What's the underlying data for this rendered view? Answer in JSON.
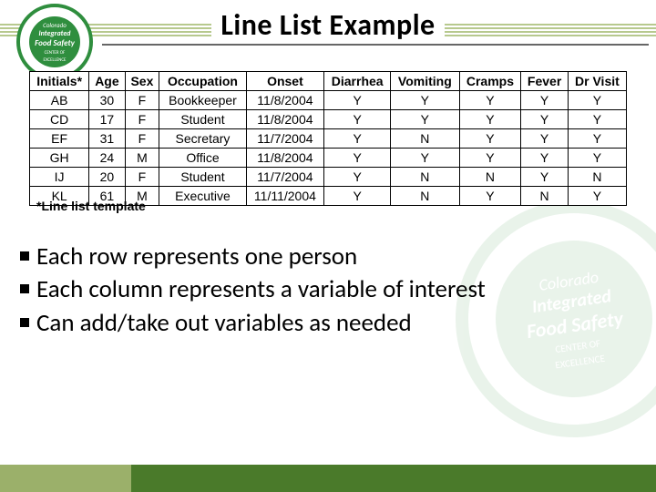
{
  "title": "Line List Example",
  "logo": {
    "line1": "Colorado",
    "line2": "Integrated",
    "line3": "Food Safety",
    "line4": "CENTER OF",
    "line5": "EXCELLENCE"
  },
  "table": {
    "headers": [
      "Initials*",
      "Age",
      "Sex",
      "Occupation",
      "Onset",
      "Diarrhea",
      "Vomiting",
      "Cramps",
      "Fever",
      "Dr Visit"
    ],
    "rows": [
      [
        "AB",
        "30",
        "F",
        "Bookkeeper",
        "11/8/2004",
        "Y",
        "Y",
        "Y",
        "Y",
        "Y"
      ],
      [
        "CD",
        "17",
        "F",
        "Student",
        "11/8/2004",
        "Y",
        "Y",
        "Y",
        "Y",
        "Y"
      ],
      [
        "EF",
        "31",
        "F",
        "Secretary",
        "11/7/2004",
        "Y",
        "N",
        "Y",
        "Y",
        "Y"
      ],
      [
        "GH",
        "24",
        "M",
        "Office",
        "11/8/2004",
        "Y",
        "Y",
        "Y",
        "Y",
        "Y"
      ],
      [
        "IJ",
        "20",
        "F",
        "Student",
        "11/7/2004",
        "Y",
        "N",
        "N",
        "Y",
        "N"
      ],
      [
        "KL",
        "61",
        "M",
        "Executive",
        "11/11/2004",
        "Y",
        "N",
        "Y",
        "N",
        "Y"
      ]
    ]
  },
  "footnote": "*Line list template",
  "bullets": [
    "Each row represents one person",
    "Each column represents a variable of interest",
    "Can add/take out variables as needed"
  ],
  "chart_data": {
    "type": "table",
    "title": "Line List Example",
    "columns": [
      "Initials*",
      "Age",
      "Sex",
      "Occupation",
      "Onset",
      "Diarrhea",
      "Vomiting",
      "Cramps",
      "Fever",
      "Dr Visit"
    ],
    "rows": [
      {
        "Initials*": "AB",
        "Age": 30,
        "Sex": "F",
        "Occupation": "Bookkeeper",
        "Onset": "11/8/2004",
        "Diarrhea": "Y",
        "Vomiting": "Y",
        "Cramps": "Y",
        "Fever": "Y",
        "Dr Visit": "Y"
      },
      {
        "Initials*": "CD",
        "Age": 17,
        "Sex": "F",
        "Occupation": "Student",
        "Onset": "11/8/2004",
        "Diarrhea": "Y",
        "Vomiting": "Y",
        "Cramps": "Y",
        "Fever": "Y",
        "Dr Visit": "Y"
      },
      {
        "Initials*": "EF",
        "Age": 31,
        "Sex": "F",
        "Occupation": "Secretary",
        "Onset": "11/7/2004",
        "Diarrhea": "Y",
        "Vomiting": "N",
        "Cramps": "Y",
        "Fever": "Y",
        "Dr Visit": "Y"
      },
      {
        "Initials*": "GH",
        "Age": 24,
        "Sex": "M",
        "Occupation": "Office",
        "Onset": "11/8/2004",
        "Diarrhea": "Y",
        "Vomiting": "Y",
        "Cramps": "Y",
        "Fever": "Y",
        "Dr Visit": "Y"
      },
      {
        "Initials*": "IJ",
        "Age": 20,
        "Sex": "F",
        "Occupation": "Student",
        "Onset": "11/7/2004",
        "Diarrhea": "Y",
        "Vomiting": "N",
        "Cramps": "N",
        "Fever": "Y",
        "Dr Visit": "N"
      },
      {
        "Initials*": "KL",
        "Age": 61,
        "Sex": "M",
        "Occupation": "Executive",
        "Onset": "11/11/2004",
        "Diarrhea": "Y",
        "Vomiting": "N",
        "Cramps": "Y",
        "Fever": "N",
        "Dr Visit": "Y"
      }
    ]
  }
}
